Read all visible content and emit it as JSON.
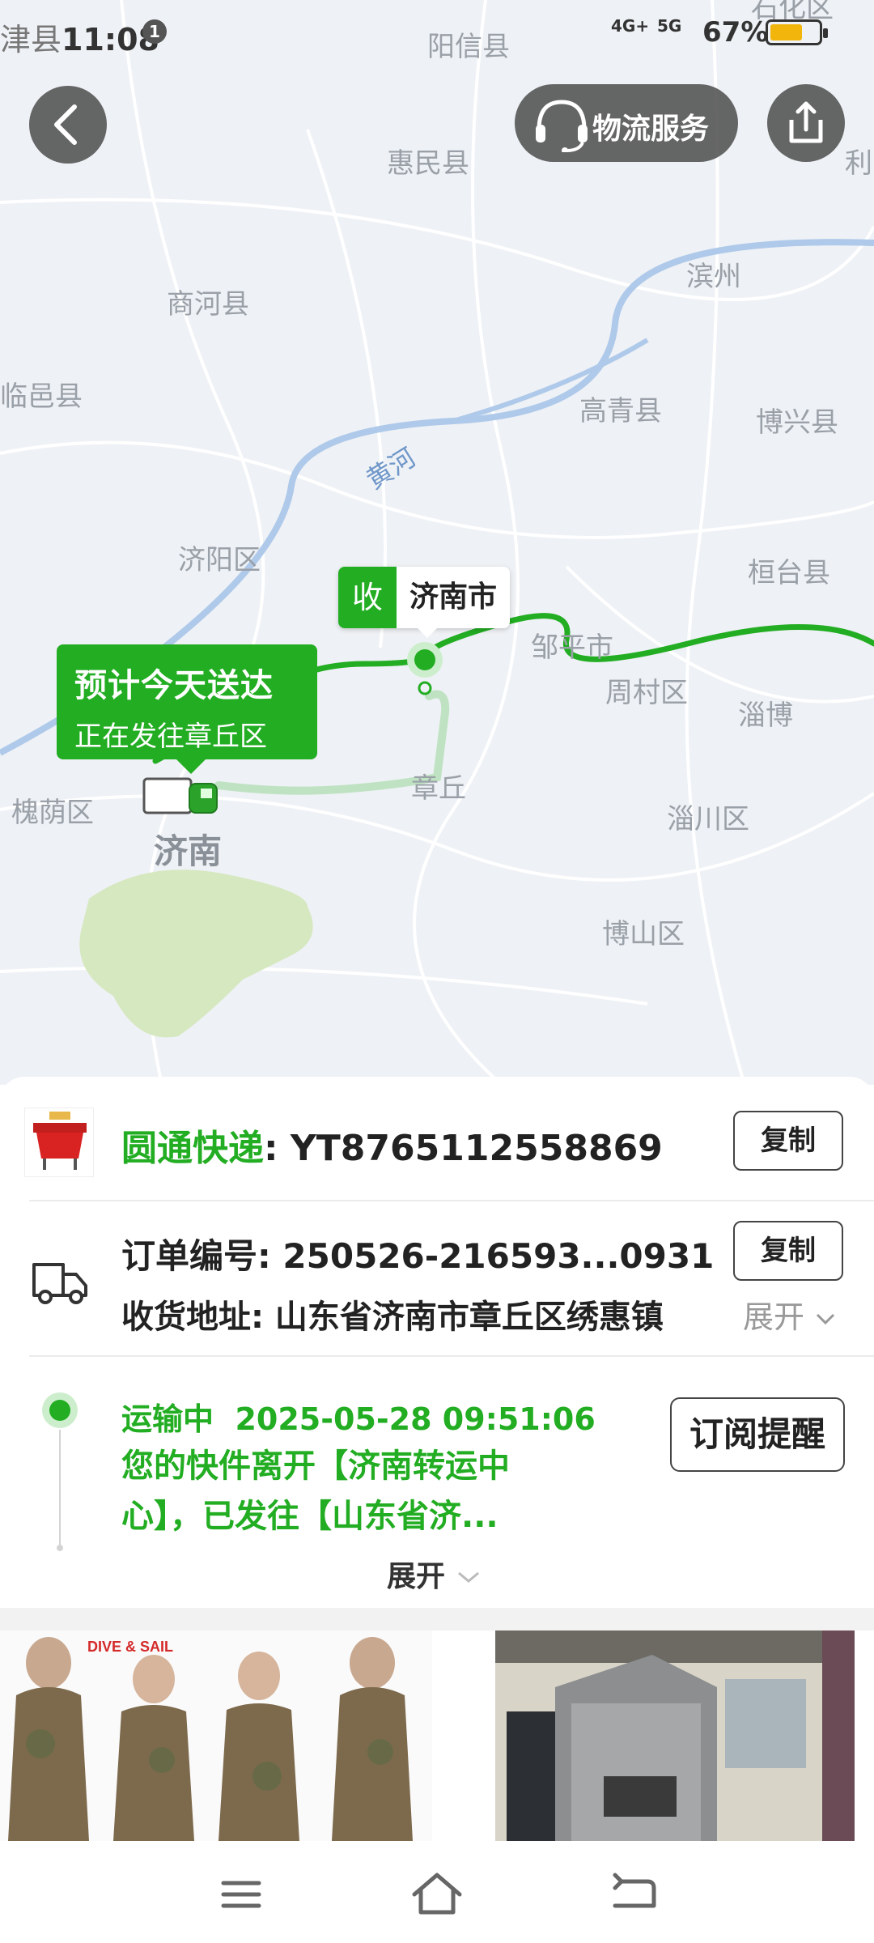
{
  "status_bar": {
    "carrier_prefix": "津县",
    "time": "11:08",
    "notification_badge": "1",
    "network_1": "4G+",
    "network_2": "5G",
    "battery_percent": "67%",
    "battery_level": 0.67
  },
  "map": {
    "cities": [
      "阳信县",
      "惠民县",
      "滨州",
      "商河县",
      "临邑县",
      "高青县",
      "博兴县",
      "济阳区",
      "桓台县",
      "邹平市",
      "周村区",
      "淄博",
      "槐荫区",
      "章丘",
      "淄川区",
      "博山区",
      "利",
      "石化区",
      "济南"
    ],
    "river_label": "黄河",
    "eta_title": "预计今天送达",
    "eta_subtitle": "正在发往章丘区",
    "receive_badge": "收",
    "receive_city": "济南市",
    "route_color": "#22ad22"
  },
  "top_actions": {
    "service_label": "物流服务"
  },
  "shipment": {
    "carrier_name": "圆通快递",
    "tracking_number": "YT8765112558869",
    "copy_label": "复制",
    "order_label": "订单编号: ",
    "order_number": "250526-216593...0931",
    "address_label": "收货地址: ",
    "address": "山东省济南市章丘区绣惠镇",
    "address_expand": "展开"
  },
  "tracking": {
    "status": "运输中",
    "timestamp": "2025-05-28 09:51:06",
    "message": "您的快件离开【济南转运中心】，已发往【山东省济...",
    "subscribe_label": "订阅提醒",
    "expand_label": "展开"
  },
  "products": [
    {
      "brand": "DIVE & SAIL",
      "name": "wetsuit"
    },
    {
      "name": "shed"
    }
  ],
  "colors": {
    "accent_green": "#22ad22",
    "battery": "#f2b50c"
  }
}
